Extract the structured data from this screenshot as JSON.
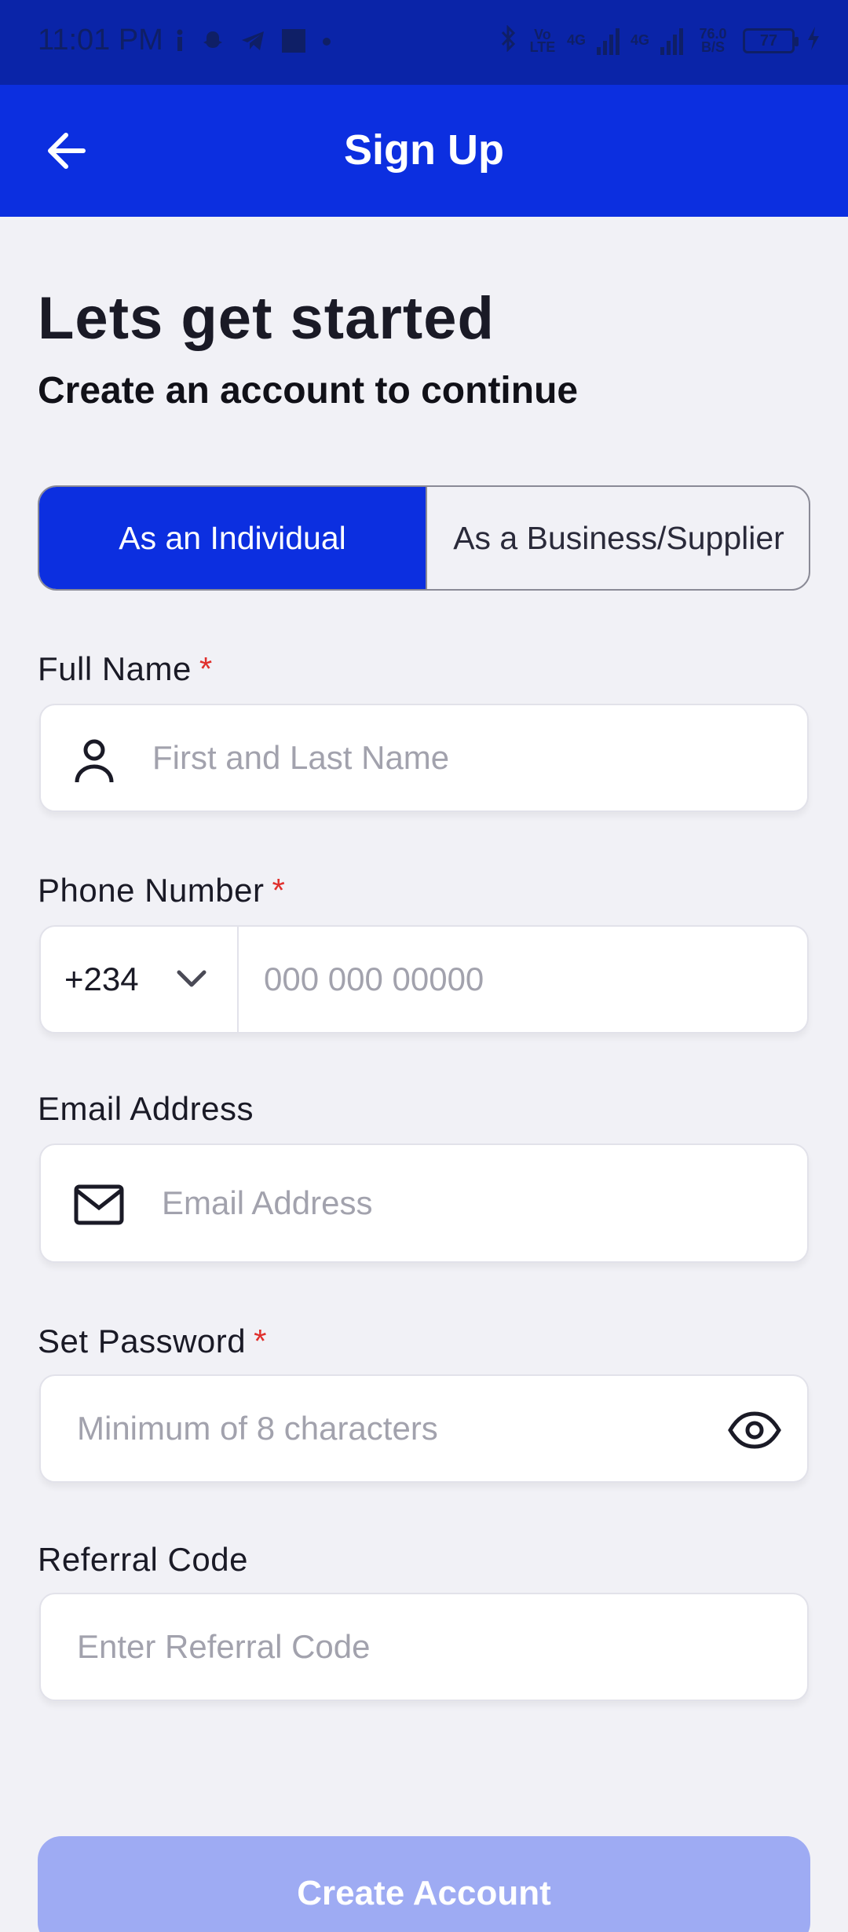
{
  "status_bar": {
    "time": "11:01 PM",
    "network_1": "Vo LTE",
    "network_2": "4G",
    "network_3": "4G",
    "speed": "76.0 B/S",
    "battery": "77"
  },
  "app_bar": {
    "title": "Sign Up",
    "back_icon": "arrow-left-icon"
  },
  "intro": {
    "heading": "Lets get started",
    "subheading": "Create an account to continue"
  },
  "account_type": {
    "options": [
      {
        "label": "As an Individual",
        "selected": true
      },
      {
        "label": "As a Business/Supplier",
        "selected": false
      }
    ]
  },
  "form": {
    "full_name": {
      "label": "Full Name",
      "required_mark": "*",
      "placeholder": "First and Last Name",
      "icon": "person-icon"
    },
    "phone": {
      "label": "Phone Number",
      "required_mark": "*",
      "country_code": "+234",
      "placeholder": "000 000 00000",
      "icon": "chevron-down-icon"
    },
    "email": {
      "label": "Email Address",
      "placeholder": "Email Address",
      "icon": "mail-icon"
    },
    "password": {
      "label": "Set Password",
      "required_mark": "*",
      "placeholder": "Minimum of 8 characters",
      "icon": "eye-icon"
    },
    "referral": {
      "label": "Referral Code",
      "placeholder": "Enter Referral Code"
    }
  },
  "cta": {
    "label": "Create Account"
  },
  "colors": {
    "primary": "#0c2fe0",
    "status_bar": "#0a24a8",
    "cta_disabled": "#9eabf3",
    "required": "#e0302d",
    "background": "#f1f1f6"
  }
}
